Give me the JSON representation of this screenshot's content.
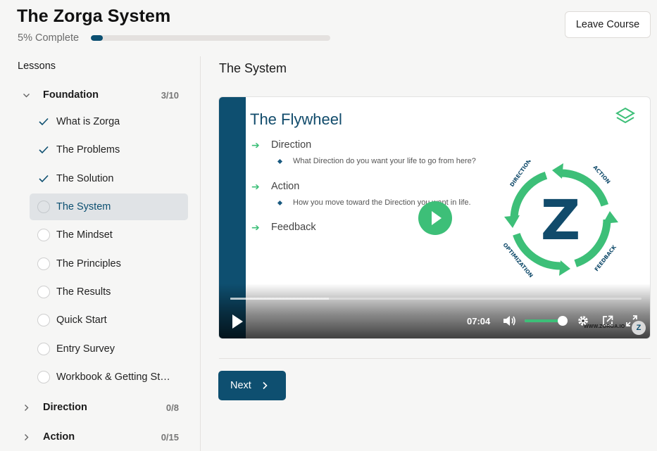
{
  "course": {
    "title": "The Zorga System",
    "progress_text": "5% Complete",
    "progress_fraction": 0.05,
    "leave_label": "Leave Course"
  },
  "sidebar": {
    "heading": "Lessons",
    "sections": [
      {
        "name": "Foundation",
        "count": "3/10",
        "expanded": true
      },
      {
        "name": "Direction",
        "count": "0/8",
        "expanded": false
      },
      {
        "name": "Action",
        "count": "0/15",
        "expanded": false
      }
    ],
    "lessons": [
      {
        "label": "What is Zorga",
        "status": "complete"
      },
      {
        "label": "The Problems",
        "status": "complete"
      },
      {
        "label": "The Solution",
        "status": "complete"
      },
      {
        "label": "The System",
        "status": "current"
      },
      {
        "label": "The Mindset",
        "status": "incomplete"
      },
      {
        "label": "The Principles",
        "status": "incomplete"
      },
      {
        "label": "The Results",
        "status": "incomplete"
      },
      {
        "label": "Quick Start",
        "status": "incomplete"
      },
      {
        "label": "Entry Survey",
        "status": "incomplete"
      },
      {
        "label": "Workbook & Getting Started",
        "status": "incomplete"
      }
    ]
  },
  "main": {
    "lesson_title": "The System",
    "next_label": "Next"
  },
  "video": {
    "time": "07:04",
    "volume_fraction": 0.95,
    "buffered_fraction": 0.24,
    "watermark": "WWW.ZORGA.IO",
    "watermark_badge": "Z",
    "slide": {
      "title": "The Flywheel",
      "items": [
        {
          "head": "Direction",
          "bullet": "What Direction do you want your life to go from here?"
        },
        {
          "head": "Action",
          "bullet": "How you move toward the Direction you want in life."
        },
        {
          "head": "Feedback",
          "bullet": ""
        }
      ],
      "wheel_letter": "Z",
      "wheel_labels": [
        "DIRECTION",
        "ACTION",
        "FEEDBACK",
        "OPTIMIZATION"
      ]
    }
  },
  "colors": {
    "brand": "#0e4f70",
    "accent_green": "#3dbf78",
    "background": "#f6f6f5"
  }
}
